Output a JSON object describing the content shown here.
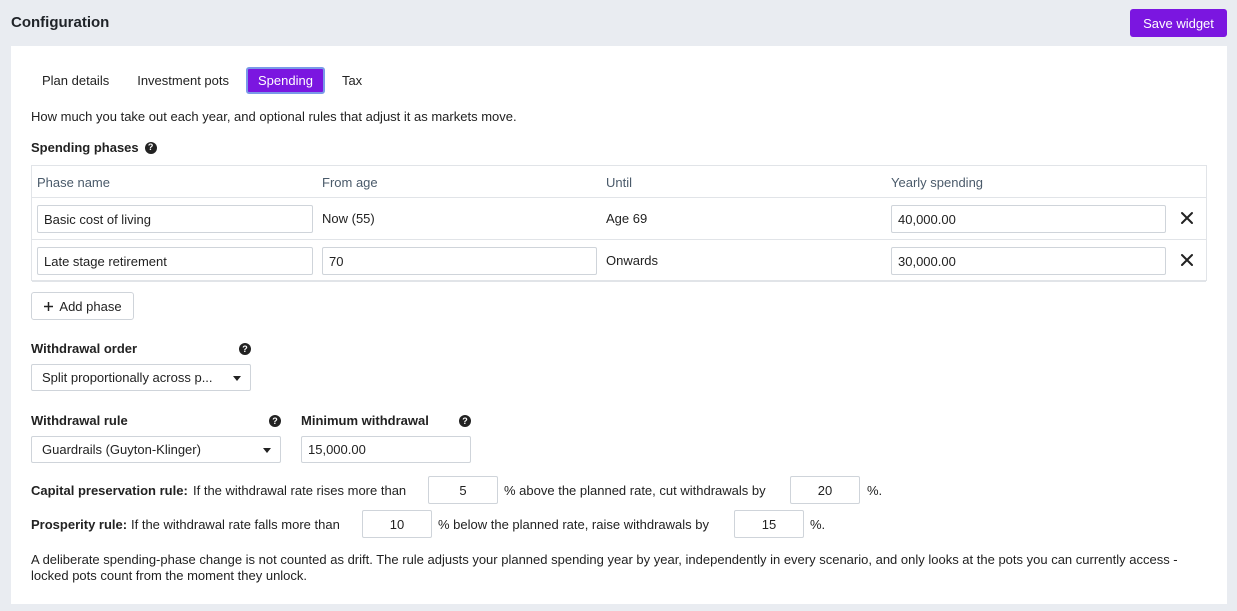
{
  "header": {
    "title": "Configuration",
    "save_label": "Save widget"
  },
  "tabs": [
    {
      "label": "Plan details",
      "active": false
    },
    {
      "label": "Investment pots",
      "active": false
    },
    {
      "label": "Spending",
      "active": true
    },
    {
      "label": "Tax",
      "active": false
    }
  ],
  "intro": "How much you take out each year, and optional rules that adjust it as markets move.",
  "spending_phases": {
    "label": "Spending phases",
    "columns": [
      "Phase name",
      "From age",
      "Until",
      "Yearly spending"
    ],
    "rows": [
      {
        "name": "Basic cost of living",
        "from": "Now (55)",
        "until": "Age 69",
        "yearly": "40,000.00"
      },
      {
        "name": "Late stage retirement",
        "from": "70",
        "until": "Onwards",
        "yearly": "30,000.00"
      }
    ],
    "add_label": "Add phase"
  },
  "withdrawal_order": {
    "label": "Withdrawal order",
    "value": "Split proportionally across p..."
  },
  "withdrawal_rule": {
    "label": "Withdrawal rule",
    "value": "Guardrails (Guyton-Klinger)"
  },
  "minimum_withdrawal": {
    "label": "Minimum withdrawal",
    "value": "15,000.00"
  },
  "capital_rule": {
    "title": "Capital preservation rule:",
    "text1": "If the withdrawal rate rises more than",
    "value1": "5",
    "text2": "% above the planned rate, cut withdrawals by",
    "value2": "20",
    "text3": "%."
  },
  "prosperity_rule": {
    "title": "Prosperity rule:",
    "text1": "If the withdrawal rate falls more than",
    "value1": "10",
    "text2": "% below the planned rate, raise withdrawals by",
    "value2": "15",
    "text3": "%."
  },
  "note": "A deliberate spending-phase change is not counted as drift. The rule adjusts your planned spending year by year, independently in every scenario, and only looks at the pots you can currently access - locked pots count from the moment they unlock.",
  "colors": {
    "accent": "#7b16e0",
    "active_tab_border": "#7a9ae8",
    "background": "#e9ecf1"
  }
}
